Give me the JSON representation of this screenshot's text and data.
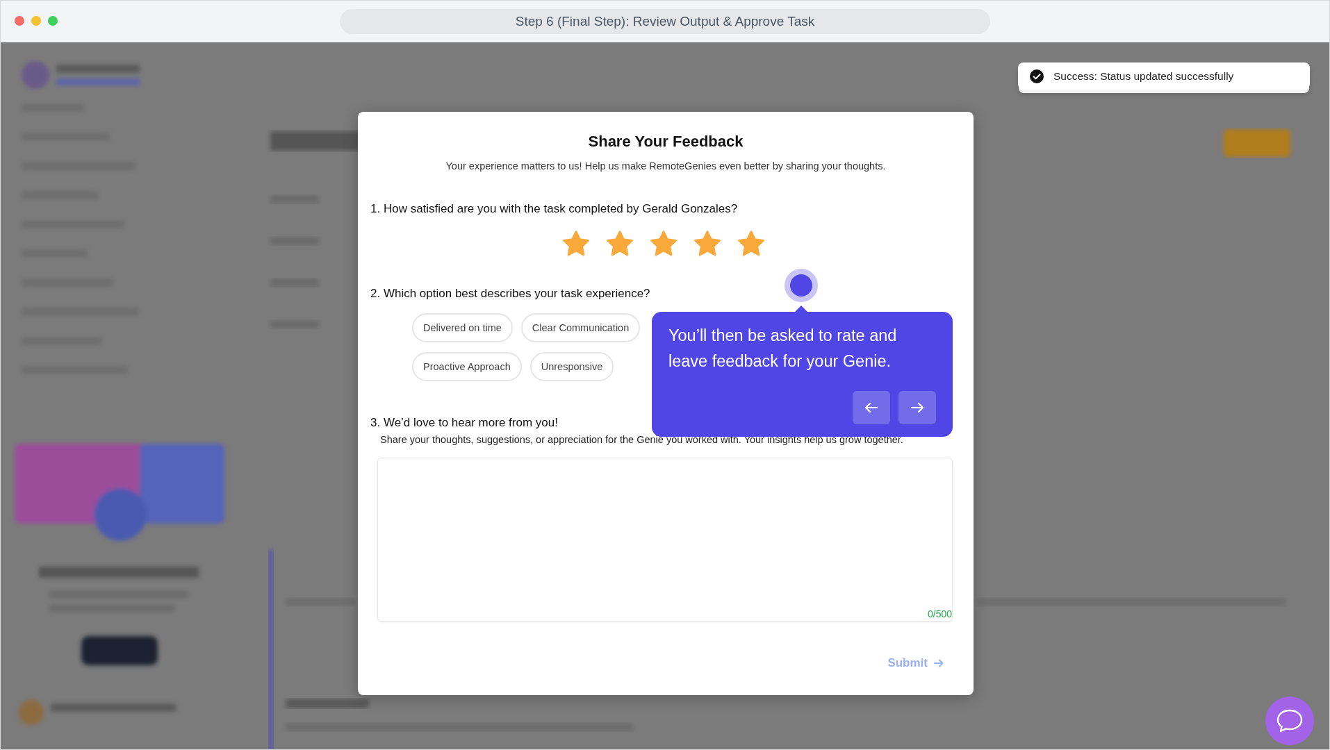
{
  "window": {
    "title": "Step 6 (Final Step): Review Output & Approve Task"
  },
  "toast": {
    "message": "Success: Status updated successfully"
  },
  "modal": {
    "title": "Share Your Feedback",
    "subtitle": "Your experience matters to us! Help us make RemoteGenies even better by sharing your thoughts.",
    "question_1": {
      "label": "1. How satisfied are you with the task completed by Gerald Gonzales?",
      "stars": 5
    },
    "question_2": {
      "label": "2. Which option best describes your task experience?",
      "options": [
        {
          "label": "Delivered on time",
          "selected": false
        },
        {
          "label": "Clear Communication",
          "selected": false
        },
        {
          "label": "Proactive Approach",
          "selected": false
        },
        {
          "label": "Unresponsive",
          "selected": false
        }
      ]
    },
    "question_3": {
      "label": "3. We’d love to hear more from you!",
      "hint": "Share your thoughts, suggestions, or appreciation for the Genie you worked with. Your insights help us grow together.",
      "counter": "0/500"
    },
    "submit": {
      "label": "Submit",
      "disabled": true
    }
  },
  "tour": {
    "text": "You’ll then be asked to rate and leave feedback for your Genie."
  }
}
